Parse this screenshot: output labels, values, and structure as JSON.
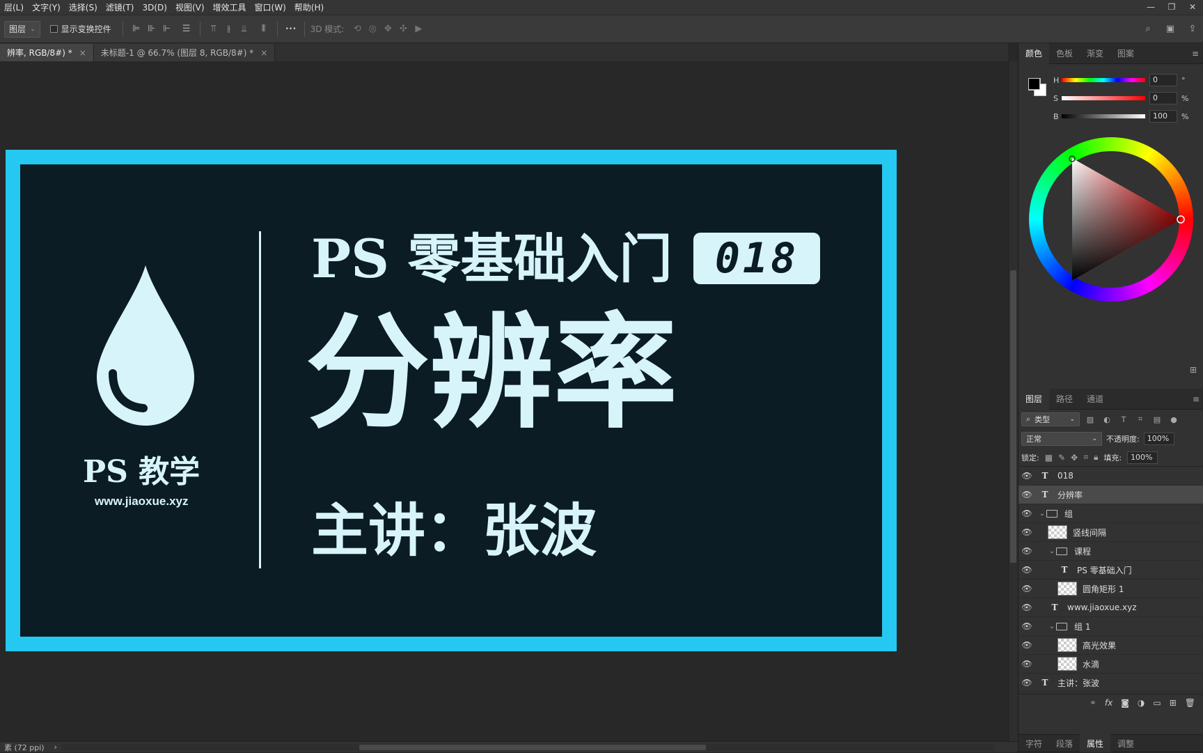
{
  "menu": [
    "层(L)",
    "文字(Y)",
    "选择(S)",
    "滤镜(T)",
    "3D(D)",
    "视图(V)",
    "增效工具",
    "窗口(W)",
    "帮助(H)"
  ],
  "window_controls": {
    "minimize": "—",
    "restore": "❐",
    "close": "✕"
  },
  "options": {
    "select_value": "图层",
    "show_transform": "显示变换控件",
    "mode_3d": "3D 模式:",
    "more": "•••"
  },
  "tabs": [
    {
      "label": "辨率, RGB/8#) *",
      "close": "×"
    },
    {
      "label": "未标题-1 @ 66.7% (图层 8, RGB/8#) *",
      "close": "×"
    }
  ],
  "canvas": {
    "title_line": "PS 零基础入门",
    "badge": "018",
    "main_title": "分辨率",
    "lecturer": "主讲：张波",
    "logo_text": "PS 教学",
    "url": "www.jiaoxue.xyz",
    "colors": {
      "frame": "#24c8f0",
      "bg": "#0b1c24",
      "text": "#d8f4fb"
    }
  },
  "status": {
    "zoom": "素 (72 ppi)",
    "arrow": "›"
  },
  "color_panel": {
    "tabs": [
      "颜色",
      "色板",
      "渐变",
      "图案"
    ],
    "sliders": [
      {
        "label": "H",
        "value": "0",
        "unit": "°"
      },
      {
        "label": "S",
        "value": "0",
        "unit": "%"
      },
      {
        "label": "B",
        "value": "100",
        "unit": "%"
      }
    ]
  },
  "layers_panel": {
    "tabs": [
      "图层",
      "路径",
      "通道"
    ],
    "filter_label": "类型",
    "blend_mode": "正常",
    "opacity_label": "不透明度:",
    "opacity_value": "100%",
    "lock_label": "锁定:",
    "fill_label": "填充:",
    "fill_value": "100%",
    "layers": [
      {
        "name": "018",
        "kind": "text",
        "indent": 0,
        "selected": false
      },
      {
        "name": "分辨率",
        "kind": "text",
        "indent": 0,
        "selected": true
      },
      {
        "name": "组",
        "kind": "group",
        "indent": 0,
        "selected": false
      },
      {
        "name": "竖线间隔",
        "kind": "pixel",
        "indent": 1,
        "selected": false
      },
      {
        "name": "课程",
        "kind": "group",
        "indent": 1,
        "selected": false
      },
      {
        "name": "PS 零基础入门",
        "kind": "text",
        "indent": 2,
        "selected": false
      },
      {
        "name": "圆角矩形 1",
        "kind": "pixel",
        "indent": 2,
        "selected": false
      },
      {
        "name": "www.jiaoxue.xyz",
        "kind": "text",
        "indent": 1,
        "selected": false
      },
      {
        "name": "组 1",
        "kind": "group",
        "indent": 1,
        "selected": false
      },
      {
        "name": "高光效果",
        "kind": "pixel",
        "indent": 2,
        "selected": false
      },
      {
        "name": "水滴",
        "kind": "pixel",
        "indent": 2,
        "selected": false
      },
      {
        "name": "主讲：张波",
        "kind": "text",
        "indent": 0,
        "selected": false
      }
    ]
  },
  "bottom_tabs": [
    "字符",
    "段落",
    "属性",
    "调整"
  ]
}
